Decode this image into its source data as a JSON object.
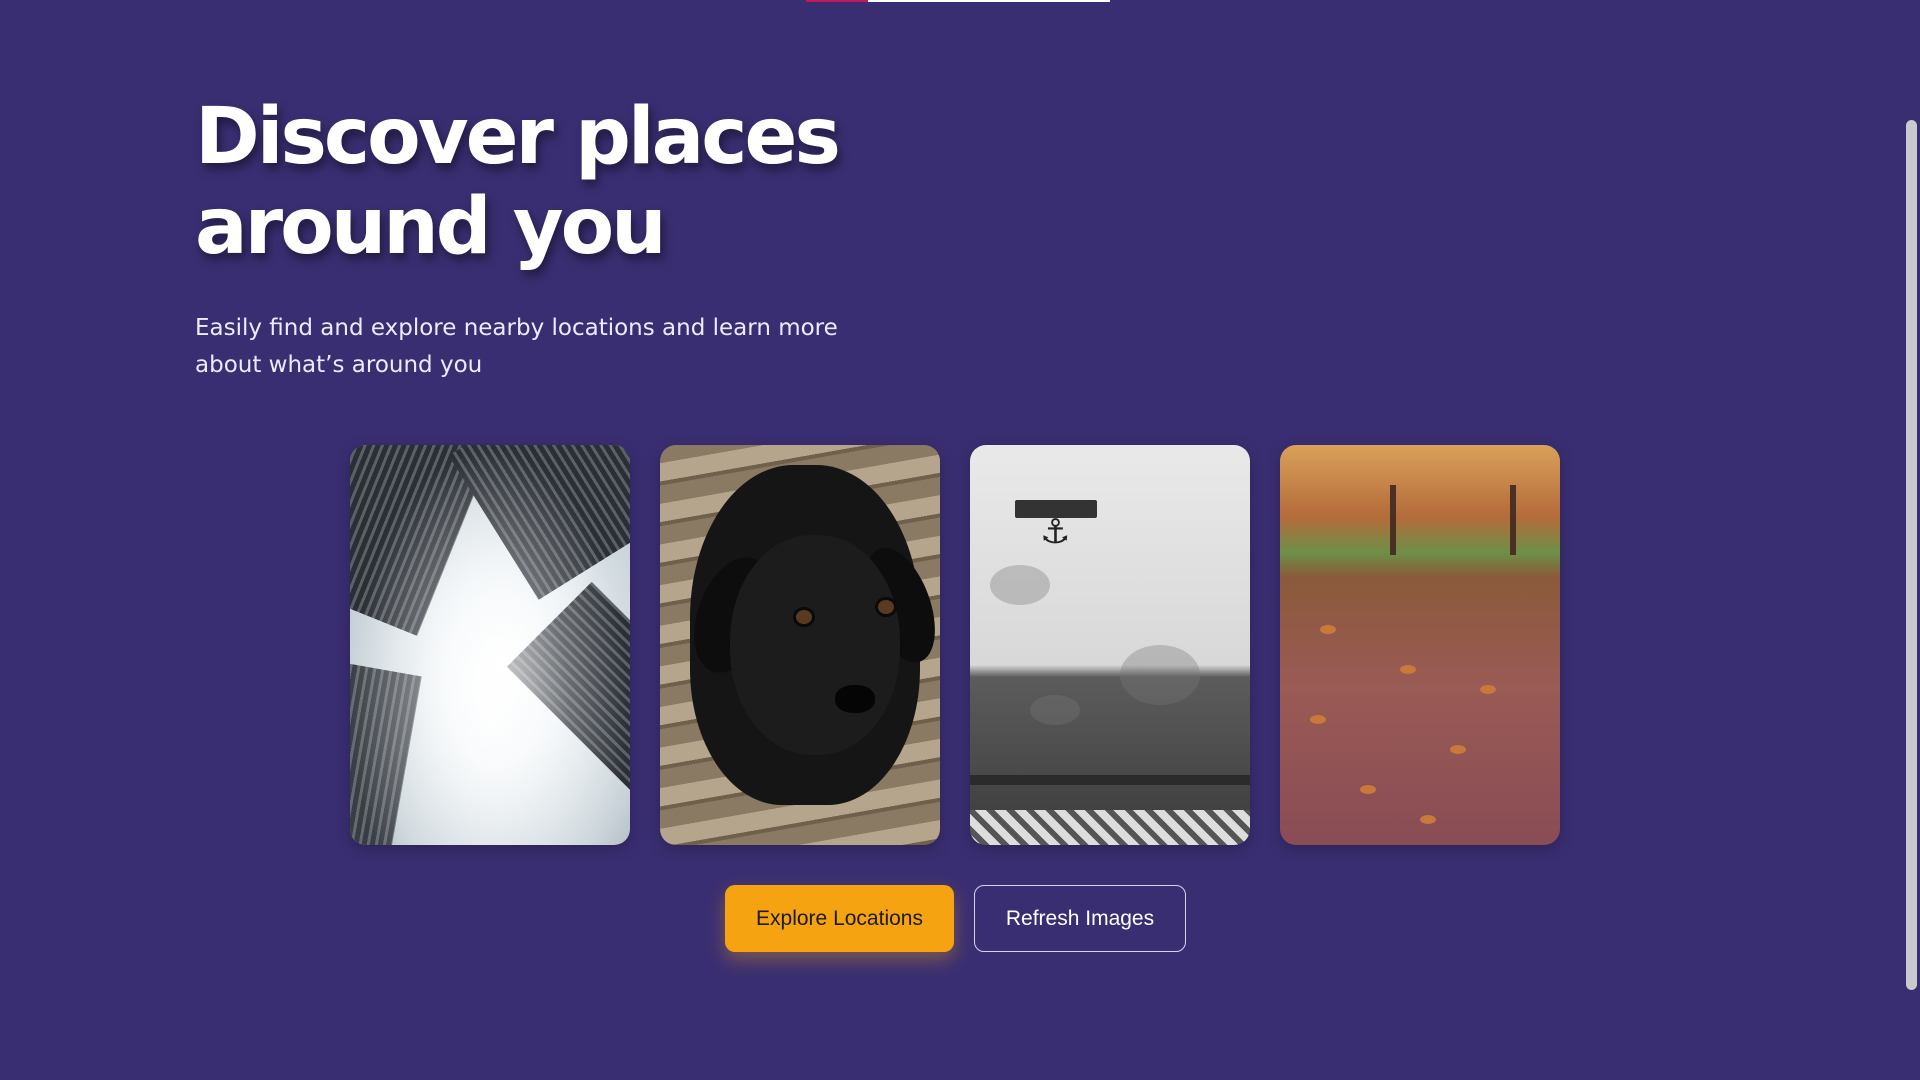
{
  "colors": {
    "background": "#3a2e72",
    "primary_button": "#f6a312",
    "accent_line": "#c2185b"
  },
  "hero": {
    "title": "Discover places around you",
    "subtitle": "Easily find and explore nearby locations and learn more about what’s around you"
  },
  "gallery": {
    "images": [
      {
        "subject": "skyscrapers-looking-up"
      },
      {
        "subject": "black-puppy-on-wooden-floor"
      },
      {
        "subject": "white-wall-with-bench"
      },
      {
        "subject": "autumn-leaves-path"
      }
    ]
  },
  "actions": {
    "explore_label": "Explore Locations",
    "refresh_label": "Refresh Images"
  }
}
